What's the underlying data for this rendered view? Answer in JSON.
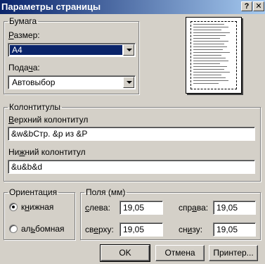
{
  "window": {
    "title": "Параметры страницы",
    "help_glyph": "?",
    "close_glyph": "✕"
  },
  "paper": {
    "group_label": "Бумага",
    "size_label_pre": "",
    "size_label_ul": "Р",
    "size_label_post": "азмер:",
    "size_value": "A4",
    "source_label_pre": "Пода",
    "source_label_ul": "ч",
    "source_label_post": "а:",
    "source_value": "Автовыбор"
  },
  "headers": {
    "group_label": "Колонтитулы",
    "header_label_pre": "",
    "header_label_ul": "В",
    "header_label_post": "ерхний колонтитул",
    "header_value": "&w&bСтр. &p из &P",
    "footer_label_pre": "Ни",
    "footer_label_ul": "ж",
    "footer_label_post": "ний колонтитул",
    "footer_value": "&u&b&d"
  },
  "orientation": {
    "group_label": "Ориентация",
    "portrait_pre": "к",
    "portrait_ul": "н",
    "portrait_post": "ижная",
    "landscape_pre": "ал",
    "landscape_ul": "ь",
    "landscape_post": "бомная",
    "selected": "portrait"
  },
  "margins": {
    "group_label": "Поля (мм)",
    "left_pre": "",
    "left_ul": "с",
    "left_post": "лева:",
    "left_value": "19,05",
    "right_pre": "спр",
    "right_ul": "а",
    "right_post": "ва:",
    "right_value": "19,05",
    "top_pre": "св",
    "top_ul": "е",
    "top_post": "рху:",
    "top_value": "19,05",
    "bottom_pre": "сн",
    "bottom_ul": "и",
    "bottom_post": "зу:",
    "bottom_value": "19,05"
  },
  "buttons": {
    "ok": "OK",
    "cancel": "Отмена",
    "printer": "Принтер..."
  }
}
